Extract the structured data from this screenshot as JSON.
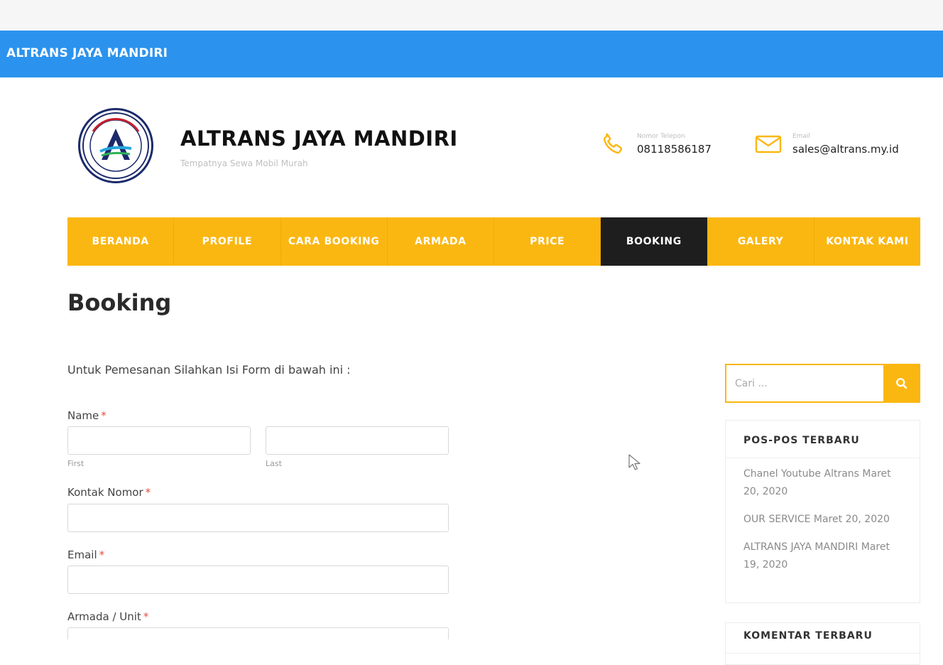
{
  "topbar": {
    "brand": "ALTRANS JAYA MANDIRI"
  },
  "header": {
    "site_title": "ALTRANS JAYA MANDIRI",
    "tagline": "Tempatnya Sewa Mobil Murah",
    "phone": {
      "label": "Nomor Telepon",
      "value": "08118586187"
    },
    "email": {
      "label": "Email",
      "value": "sales@altrans.my.id"
    }
  },
  "nav": {
    "items": [
      {
        "label": "BERANDA"
      },
      {
        "label": "PROFILE"
      },
      {
        "label": "CARA BOOKING"
      },
      {
        "label": "ARMADA"
      },
      {
        "label": "PRICE"
      },
      {
        "label": "BOOKING"
      },
      {
        "label": "GALERY"
      },
      {
        "label": "KONTAK KAMI"
      }
    ],
    "active": "BOOKING"
  },
  "page": {
    "title": "Booking",
    "intro": "Untuk Pemesanan Silahkan Isi Form di bawah ini :"
  },
  "form": {
    "name_label": "Name",
    "first_sub": "First",
    "last_sub": "Last",
    "contact_label": "Kontak Nomor",
    "email_label": "Email",
    "armada_label": "Armada / Unit",
    "required_mark": "*"
  },
  "sidebar": {
    "search_placeholder": "Cari ...",
    "recent_title": "POS-POS TERBARU",
    "recent_posts": [
      "Chanel Youtube Altrans Maret 20, 2020",
      "OUR SERVICE Maret 20, 2020",
      "ALTRANS JAYA MANDIRI Maret 19, 2020"
    ],
    "comments_title": "KOMENTAR TERBARU"
  },
  "colors": {
    "accent": "#fbb711",
    "topbar": "#2b93ee",
    "active_nav": "#1e1e1e"
  },
  "icons": {
    "phone": "phone-icon",
    "email": "envelope-icon",
    "search": "search-icon"
  }
}
